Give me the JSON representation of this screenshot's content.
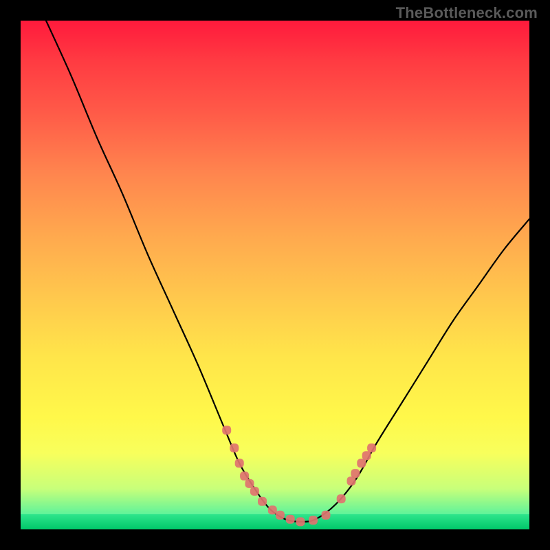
{
  "watermark_text": "TheBottleneck.com",
  "chart_data": {
    "type": "line",
    "title": "",
    "xlabel": "",
    "ylabel": "",
    "xlim": [
      0,
      100
    ],
    "ylim": [
      0,
      100
    ],
    "series": [
      {
        "name": "bottleneck-curve",
        "x": [
          5,
          10,
          15,
          20,
          25,
          30,
          35,
          40,
          43,
          46,
          49,
          52,
          55,
          58,
          62,
          66,
          70,
          75,
          80,
          85,
          90,
          95,
          100
        ],
        "values": [
          100,
          89,
          77,
          66,
          54,
          43,
          32,
          20,
          13,
          8,
          4,
          2,
          1.5,
          2,
          5,
          10,
          17,
          25,
          33,
          41,
          48,
          55,
          61
        ]
      }
    ],
    "markers": {
      "name": "sample-points",
      "color": "#e0736f",
      "x": [
        40.5,
        42.0,
        43.0,
        44.0,
        45.0,
        46.0,
        47.5,
        49.5,
        51.0,
        53.0,
        55.0,
        57.5,
        60.0,
        63.0,
        65.0,
        65.8,
        67.0,
        68.0,
        69.0
      ],
      "values": [
        19.5,
        16.0,
        13.0,
        10.5,
        9.0,
        7.5,
        5.5,
        3.8,
        2.8,
        2.0,
        1.5,
        1.8,
        2.8,
        6.0,
        9.5,
        11.0,
        13.0,
        14.5,
        16.0
      ]
    },
    "legend_visible": false,
    "grid": false
  }
}
